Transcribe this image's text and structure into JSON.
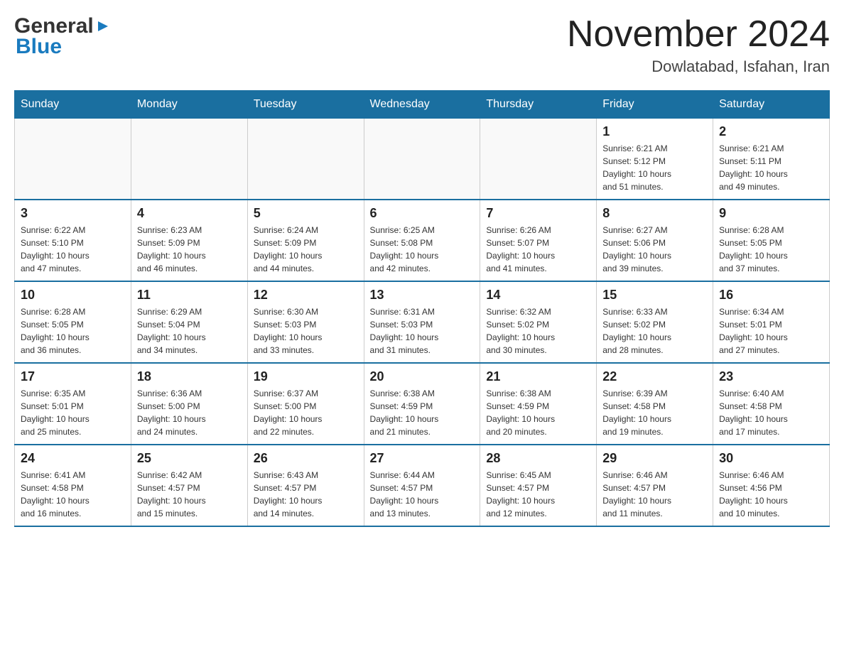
{
  "header": {
    "logo_general": "General",
    "logo_blue": "Blue",
    "month_title": "November 2024",
    "location": "Dowlatabad, Isfahan, Iran"
  },
  "weekdays": [
    "Sunday",
    "Monday",
    "Tuesday",
    "Wednesday",
    "Thursday",
    "Friday",
    "Saturday"
  ],
  "weeks": [
    [
      {
        "day": "",
        "info": ""
      },
      {
        "day": "",
        "info": ""
      },
      {
        "day": "",
        "info": ""
      },
      {
        "day": "",
        "info": ""
      },
      {
        "day": "",
        "info": ""
      },
      {
        "day": "1",
        "info": "Sunrise: 6:21 AM\nSunset: 5:12 PM\nDaylight: 10 hours\nand 51 minutes."
      },
      {
        "day": "2",
        "info": "Sunrise: 6:21 AM\nSunset: 5:11 PM\nDaylight: 10 hours\nand 49 minutes."
      }
    ],
    [
      {
        "day": "3",
        "info": "Sunrise: 6:22 AM\nSunset: 5:10 PM\nDaylight: 10 hours\nand 47 minutes."
      },
      {
        "day": "4",
        "info": "Sunrise: 6:23 AM\nSunset: 5:09 PM\nDaylight: 10 hours\nand 46 minutes."
      },
      {
        "day": "5",
        "info": "Sunrise: 6:24 AM\nSunset: 5:09 PM\nDaylight: 10 hours\nand 44 minutes."
      },
      {
        "day": "6",
        "info": "Sunrise: 6:25 AM\nSunset: 5:08 PM\nDaylight: 10 hours\nand 42 minutes."
      },
      {
        "day": "7",
        "info": "Sunrise: 6:26 AM\nSunset: 5:07 PM\nDaylight: 10 hours\nand 41 minutes."
      },
      {
        "day": "8",
        "info": "Sunrise: 6:27 AM\nSunset: 5:06 PM\nDaylight: 10 hours\nand 39 minutes."
      },
      {
        "day": "9",
        "info": "Sunrise: 6:28 AM\nSunset: 5:05 PM\nDaylight: 10 hours\nand 37 minutes."
      }
    ],
    [
      {
        "day": "10",
        "info": "Sunrise: 6:28 AM\nSunset: 5:05 PM\nDaylight: 10 hours\nand 36 minutes."
      },
      {
        "day": "11",
        "info": "Sunrise: 6:29 AM\nSunset: 5:04 PM\nDaylight: 10 hours\nand 34 minutes."
      },
      {
        "day": "12",
        "info": "Sunrise: 6:30 AM\nSunset: 5:03 PM\nDaylight: 10 hours\nand 33 minutes."
      },
      {
        "day": "13",
        "info": "Sunrise: 6:31 AM\nSunset: 5:03 PM\nDaylight: 10 hours\nand 31 minutes."
      },
      {
        "day": "14",
        "info": "Sunrise: 6:32 AM\nSunset: 5:02 PM\nDaylight: 10 hours\nand 30 minutes."
      },
      {
        "day": "15",
        "info": "Sunrise: 6:33 AM\nSunset: 5:02 PM\nDaylight: 10 hours\nand 28 minutes."
      },
      {
        "day": "16",
        "info": "Sunrise: 6:34 AM\nSunset: 5:01 PM\nDaylight: 10 hours\nand 27 minutes."
      }
    ],
    [
      {
        "day": "17",
        "info": "Sunrise: 6:35 AM\nSunset: 5:01 PM\nDaylight: 10 hours\nand 25 minutes."
      },
      {
        "day": "18",
        "info": "Sunrise: 6:36 AM\nSunset: 5:00 PM\nDaylight: 10 hours\nand 24 minutes."
      },
      {
        "day": "19",
        "info": "Sunrise: 6:37 AM\nSunset: 5:00 PM\nDaylight: 10 hours\nand 22 minutes."
      },
      {
        "day": "20",
        "info": "Sunrise: 6:38 AM\nSunset: 4:59 PM\nDaylight: 10 hours\nand 21 minutes."
      },
      {
        "day": "21",
        "info": "Sunrise: 6:38 AM\nSunset: 4:59 PM\nDaylight: 10 hours\nand 20 minutes."
      },
      {
        "day": "22",
        "info": "Sunrise: 6:39 AM\nSunset: 4:58 PM\nDaylight: 10 hours\nand 19 minutes."
      },
      {
        "day": "23",
        "info": "Sunrise: 6:40 AM\nSunset: 4:58 PM\nDaylight: 10 hours\nand 17 minutes."
      }
    ],
    [
      {
        "day": "24",
        "info": "Sunrise: 6:41 AM\nSunset: 4:58 PM\nDaylight: 10 hours\nand 16 minutes."
      },
      {
        "day": "25",
        "info": "Sunrise: 6:42 AM\nSunset: 4:57 PM\nDaylight: 10 hours\nand 15 minutes."
      },
      {
        "day": "26",
        "info": "Sunrise: 6:43 AM\nSunset: 4:57 PM\nDaylight: 10 hours\nand 14 minutes."
      },
      {
        "day": "27",
        "info": "Sunrise: 6:44 AM\nSunset: 4:57 PM\nDaylight: 10 hours\nand 13 minutes."
      },
      {
        "day": "28",
        "info": "Sunrise: 6:45 AM\nSunset: 4:57 PM\nDaylight: 10 hours\nand 12 minutes."
      },
      {
        "day": "29",
        "info": "Sunrise: 6:46 AM\nSunset: 4:57 PM\nDaylight: 10 hours\nand 11 minutes."
      },
      {
        "day": "30",
        "info": "Sunrise: 6:46 AM\nSunset: 4:56 PM\nDaylight: 10 hours\nand 10 minutes."
      }
    ]
  ]
}
